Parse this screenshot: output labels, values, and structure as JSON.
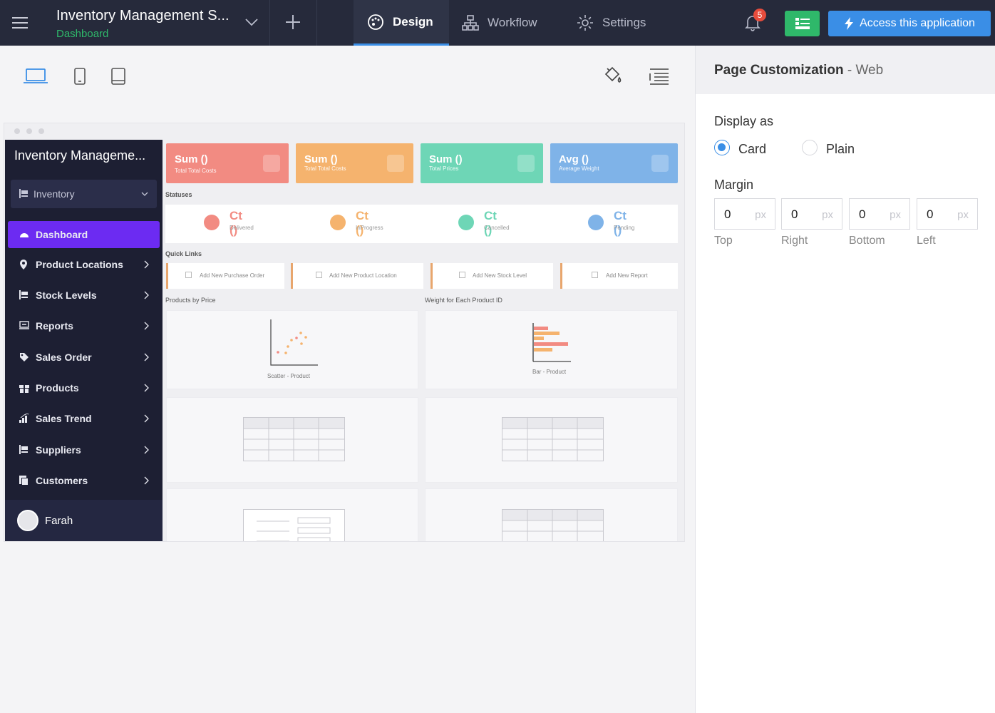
{
  "topbar": {
    "app_title": "Inventory Management S...",
    "app_subtitle": "Dashboard",
    "tabs": [
      {
        "label": "Design",
        "icon": "palette-icon",
        "active": true
      },
      {
        "label": "Workflow",
        "icon": "workflow-icon",
        "active": false
      },
      {
        "label": "Settings",
        "icon": "gear-icon",
        "active": false
      }
    ],
    "notification_count": "5",
    "access_label": "Access this application"
  },
  "right_panel": {
    "title": "Page Customization",
    "title_suffix": "- Web",
    "display_as_label": "Display as",
    "display_options": [
      {
        "label": "Card",
        "selected": true
      },
      {
        "label": "Plain",
        "selected": false
      }
    ],
    "margin_label": "Margin",
    "margin_unit": "px",
    "margins": [
      {
        "label": "Top",
        "value": "0"
      },
      {
        "label": "Right",
        "value": "0"
      },
      {
        "label": "Bottom",
        "value": "0"
      },
      {
        "label": "Left",
        "value": "0"
      }
    ]
  },
  "preview": {
    "sidebar": {
      "title": "Inventory Manageme...",
      "section_select": "Inventory",
      "menu": [
        {
          "label": "Dashboard",
          "icon": "dashboard-icon",
          "active": true
        },
        {
          "label": "Product Locations",
          "icon": "location-icon"
        },
        {
          "label": "Stock Levels",
          "icon": "stock-icon"
        },
        {
          "label": "Reports",
          "icon": "report-icon"
        },
        {
          "label": "Sales Order",
          "icon": "tag-icon"
        },
        {
          "label": "Products",
          "icon": "gift-icon"
        },
        {
          "label": "Sales Trend",
          "icon": "trend-icon"
        },
        {
          "label": "Suppliers",
          "icon": "supplier-icon"
        },
        {
          "label": "Customers",
          "icon": "customer-icon"
        }
      ],
      "user_name": "Farah"
    },
    "stat_cards": [
      {
        "value": "Sum ()",
        "label": "Total Total Costs",
        "color": "#f28b82"
      },
      {
        "value": "Sum ()",
        "label": "Total Total Costs",
        "color": "#f5b36e"
      },
      {
        "value": "Sum ()",
        "label": "Total Prices",
        "color": "#6ed6b6"
      },
      {
        "value": "Avg ()",
        "label": "Average Weight",
        "color": "#7fb3e8"
      }
    ],
    "statuses_label": "Statuses",
    "statuses": [
      {
        "value": "Ct ()",
        "label": "Delivered",
        "color": "#f28b82"
      },
      {
        "value": "Ct ()",
        "label": "InProgress",
        "color": "#f5b36e"
      },
      {
        "value": "Ct ()",
        "label": "Cancelled",
        "color": "#6ed6b6"
      },
      {
        "value": "Ct ()",
        "label": "Pending",
        "color": "#7fb3e8"
      }
    ],
    "quick_links_label": "Quick Links",
    "quick_links": [
      "Add New Purchase Order",
      "Add New Product Location",
      "Add New Stock Level",
      "Add New Report"
    ],
    "chart1_title": "Products by Price",
    "chart1_caption": "Scatter - Product",
    "chart2_title": "Weight for Each Product ID",
    "chart2_caption": "Bar - Product"
  }
}
